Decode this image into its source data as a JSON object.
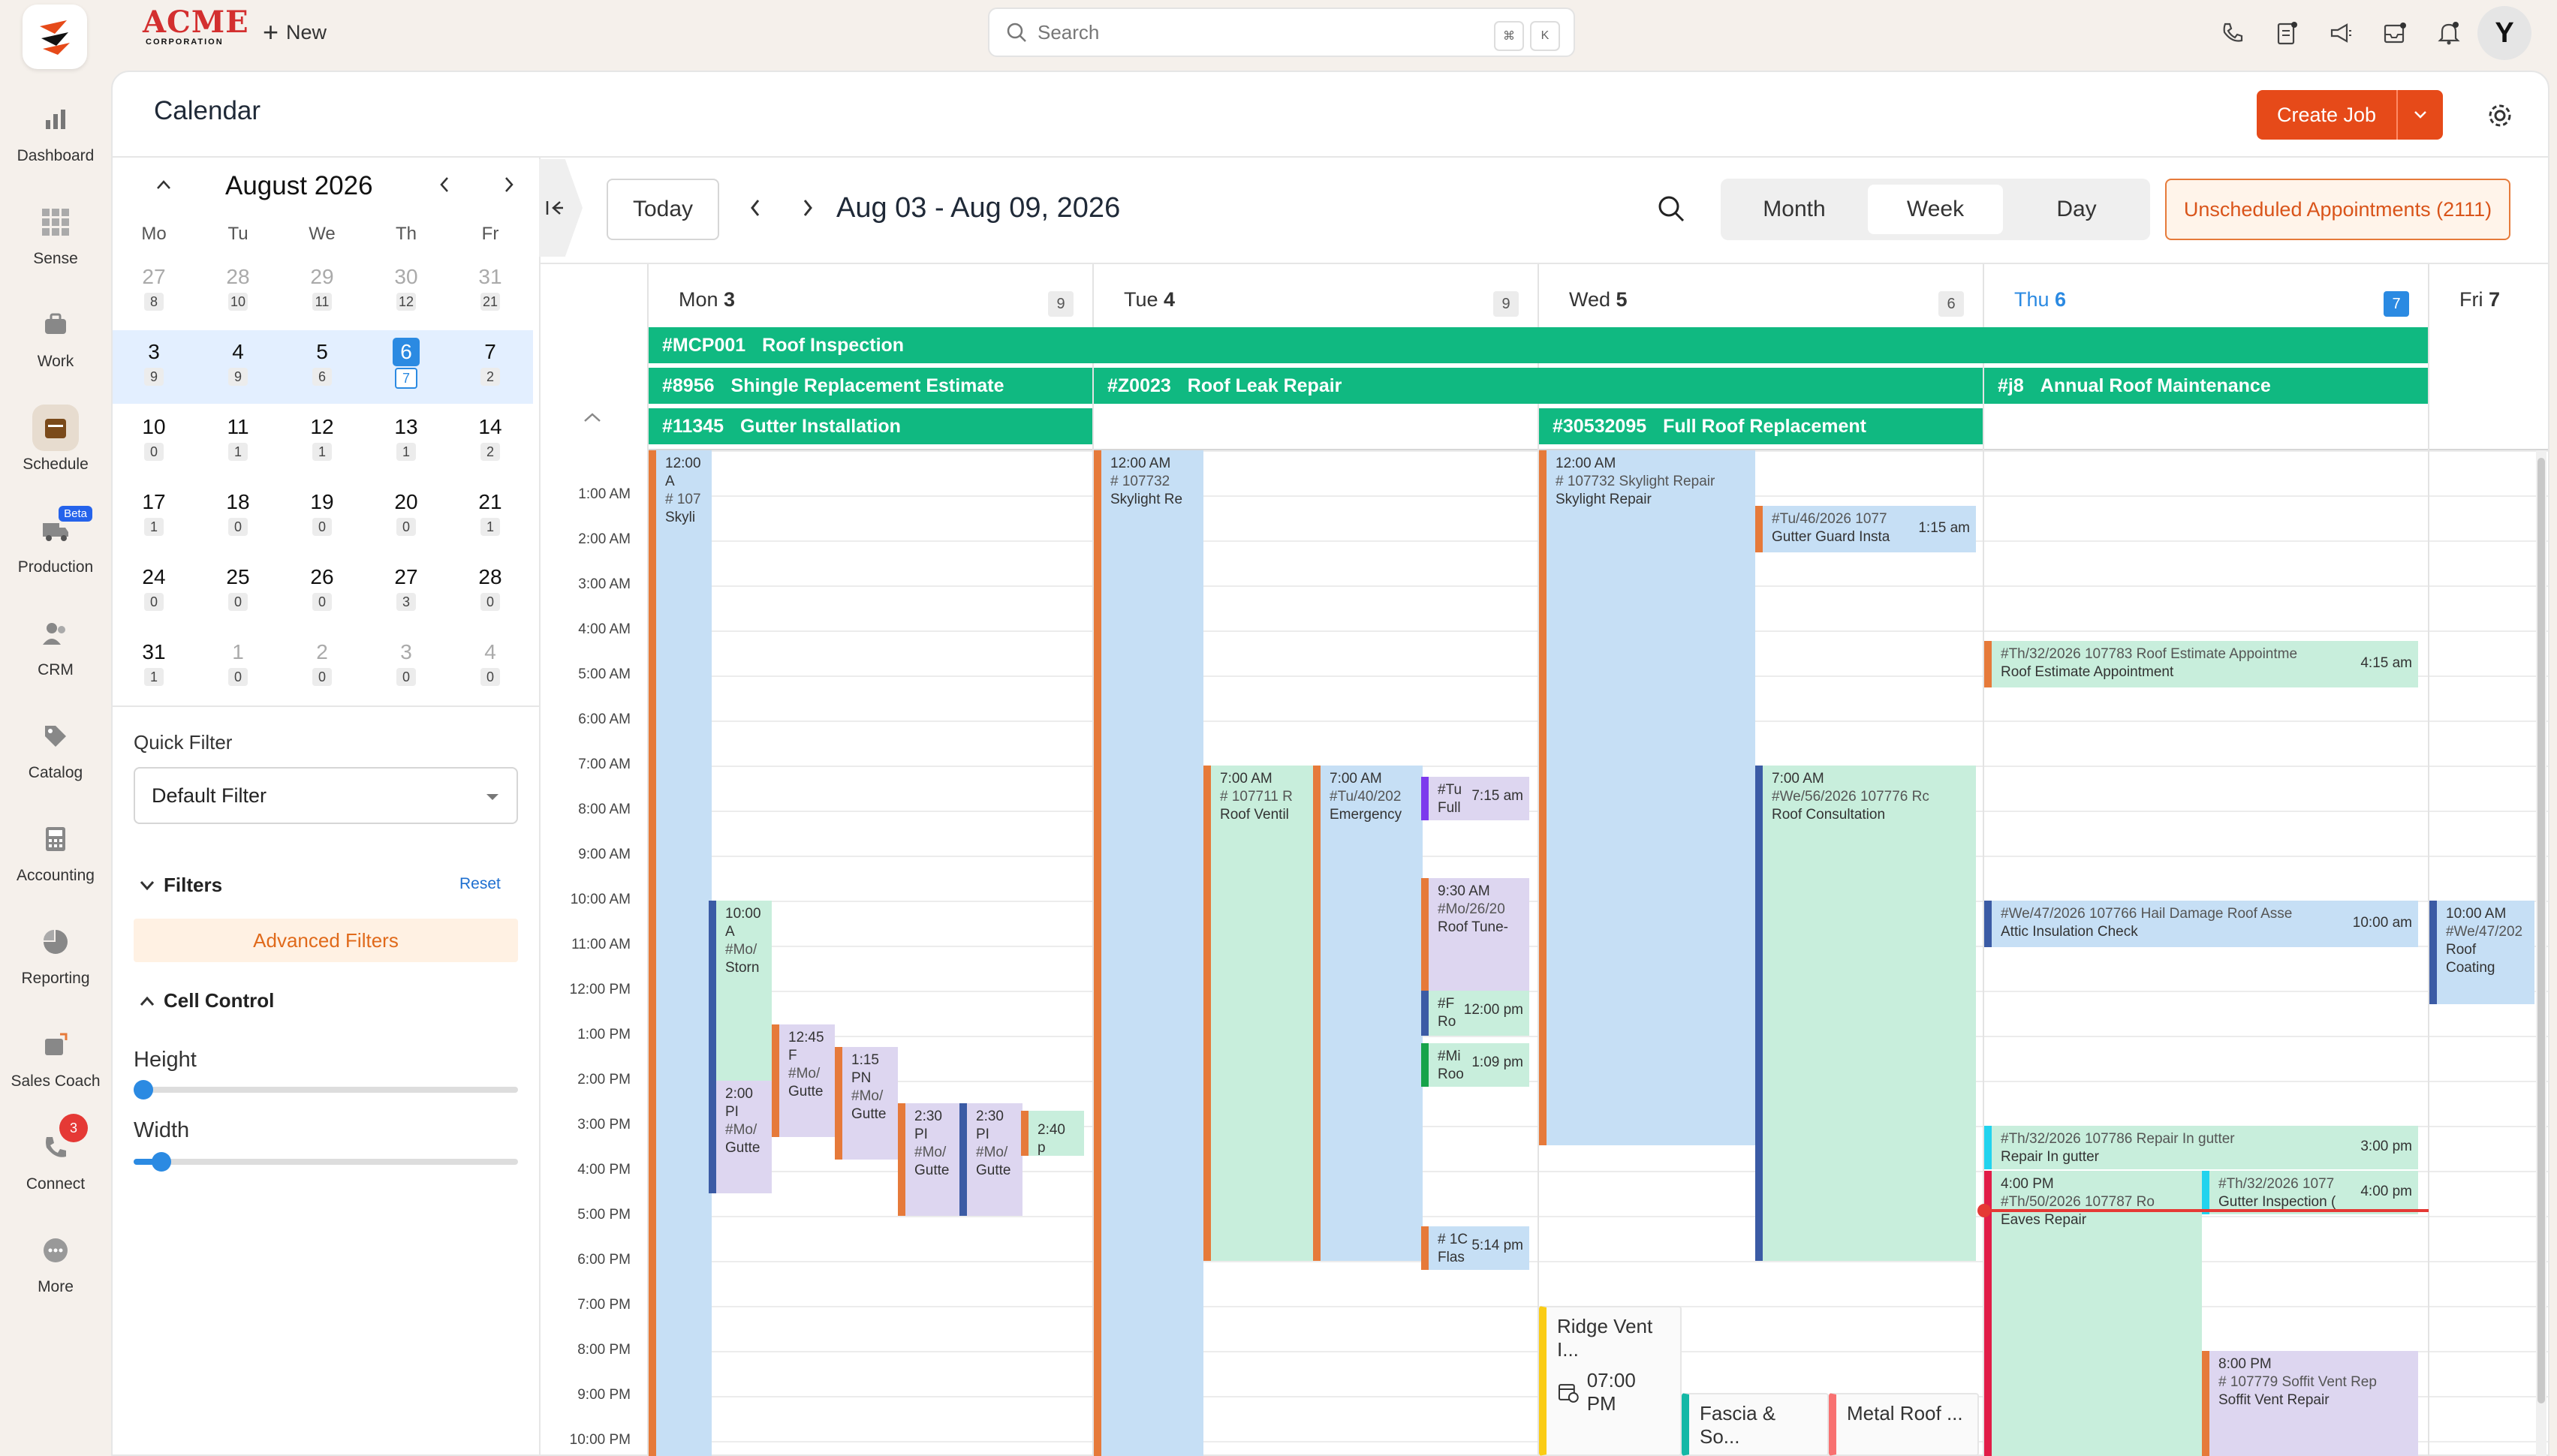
{
  "rail": {
    "items": [
      {
        "label": "Dashboard",
        "icon": "dashboard-icon"
      },
      {
        "label": "Sense",
        "icon": "sense-icon"
      },
      {
        "label": "Work",
        "icon": "work-icon"
      },
      {
        "label": "Schedule",
        "icon": "schedule-icon"
      },
      {
        "label": "Production",
        "icon": "production-icon",
        "badge": "Beta"
      },
      {
        "label": "CRM",
        "icon": "crm-icon"
      },
      {
        "label": "Catalog",
        "icon": "catalog-icon"
      },
      {
        "label": "Accounting",
        "icon": "accounting-icon"
      },
      {
        "label": "Reporting",
        "icon": "reporting-icon"
      },
      {
        "label": "Sales Coach",
        "icon": "sales-coach-icon"
      },
      {
        "label": "Connect",
        "icon": "connect-icon",
        "notif": "3"
      },
      {
        "label": "More",
        "icon": "more-icon"
      }
    ]
  },
  "topbar": {
    "brand": "ACME",
    "brand_sub": "CORPORATION",
    "new_label": "New",
    "search_placeholder": "Search",
    "kbd1": "⌘",
    "kbd2": "K",
    "avatar": "Y"
  },
  "page": {
    "title": "Calendar",
    "create_job": "Create Job"
  },
  "mini_calendar": {
    "month": "August 2026",
    "dow": [
      "Mo",
      "Tu",
      "We",
      "Th",
      "Fr"
    ],
    "weeks": [
      [
        {
          "d": "27",
          "c": "8",
          "m": true
        },
        {
          "d": "28",
          "c": "10",
          "m": true
        },
        {
          "d": "29",
          "c": "11",
          "m": true
        },
        {
          "d": "30",
          "c": "12",
          "m": true
        },
        {
          "d": "31",
          "c": "21",
          "m": true
        }
      ],
      [
        {
          "d": "3",
          "c": "9"
        },
        {
          "d": "4",
          "c": "9"
        },
        {
          "d": "5",
          "c": "6"
        },
        {
          "d": "6",
          "c": "7",
          "today": true
        },
        {
          "d": "7",
          "c": "2"
        }
      ],
      [
        {
          "d": "10",
          "c": "0"
        },
        {
          "d": "11",
          "c": "1"
        },
        {
          "d": "12",
          "c": "1"
        },
        {
          "d": "13",
          "c": "1"
        },
        {
          "d": "14",
          "c": "2"
        }
      ],
      [
        {
          "d": "17",
          "c": "1"
        },
        {
          "d": "18",
          "c": "0"
        },
        {
          "d": "19",
          "c": "0"
        },
        {
          "d": "20",
          "c": "0"
        },
        {
          "d": "21",
          "c": "1"
        }
      ],
      [
        {
          "d": "24",
          "c": "0"
        },
        {
          "d": "25",
          "c": "0"
        },
        {
          "d": "26",
          "c": "0"
        },
        {
          "d": "27",
          "c": "3"
        },
        {
          "d": "28",
          "c": "0"
        }
      ],
      [
        {
          "d": "31",
          "c": "1"
        },
        {
          "d": "1",
          "c": "0",
          "m": true
        },
        {
          "d": "2",
          "c": "0",
          "m": true
        },
        {
          "d": "3",
          "c": "0",
          "m": true
        },
        {
          "d": "4",
          "c": "0",
          "m": true
        }
      ]
    ]
  },
  "filters": {
    "quick_filter_label": "Quick Filter",
    "quick_filter_value": "Default Filter",
    "filters_label": "Filters",
    "reset": "Reset",
    "advanced": "Advanced Filters",
    "cell_control": "Cell Control",
    "height": "Height",
    "width": "Width",
    "height_value": 0,
    "width_value": 0.05
  },
  "toolbar": {
    "today": "Today",
    "range": "Aug 03 - Aug 09, 2026",
    "views": [
      "Month",
      "Week",
      "Day"
    ],
    "active_view": "Week",
    "unscheduled": "Unscheduled Appointments (2111)"
  },
  "days": [
    {
      "label": "Mon",
      "num": "3",
      "count": "9"
    },
    {
      "label": "Tue",
      "num": "4",
      "count": "9"
    },
    {
      "label": "Wed",
      "num": "5",
      "count": "6"
    },
    {
      "label": "Thu",
      "num": "6",
      "count": "7",
      "today": true
    },
    {
      "label": "Fri",
      "num": "7",
      "count": ""
    }
  ],
  "times": [
    "1:00 AM",
    "2:00 AM",
    "3:00 AM",
    "4:00 AM",
    "5:00 AM",
    "6:00 AM",
    "7:00 AM",
    "8:00 AM",
    "9:00 AM",
    "10:00 AM",
    "11:00 AM",
    "12:00 PM",
    "1:00 PM",
    "2:00 PM",
    "3:00 PM",
    "4:00 PM",
    "5:00 PM",
    "6:00 PM",
    "7:00 PM",
    "8:00 PM",
    "9:00 PM",
    "10:00 PM"
  ],
  "allday": [
    {
      "id": "#MCP001",
      "title": "Roof Inspection"
    },
    {
      "id": "#8956",
      "title": "Shingle Replacement Estimate"
    },
    {
      "id": "#Z0023",
      "title": "Roof Leak Repair"
    },
    {
      "id": "#j8",
      "title": "Annual Roof Maintenance"
    },
    {
      "id": "#11345",
      "title": "Gutter Installation"
    },
    {
      "id": "#30532095",
      "title": "Full Roof Replacement"
    }
  ],
  "events": [
    {
      "l1": "12:00 A",
      "l2": "# 107",
      "l3": "Skyli"
    },
    {
      "l1": "10:00 A",
      "l2": "#Mo/",
      "l3": "Storn"
    },
    {
      "l1": "12:45 F",
      "l2": "#Mo/",
      "l3": "Gutte"
    },
    {
      "l1": "1:15 PN",
      "l2": "#Mo/",
      "l3": "Gutte"
    },
    {
      "l1": "2:00 PI",
      "l2": "#Mo/",
      "l3": "Gutte"
    },
    {
      "l1": "2:30 PI",
      "l2": "#Mo/",
      "l3": "Gutte"
    },
    {
      "l1": "2:30 PI",
      "l2": "#Mo/",
      "l3": "Gutte"
    },
    {
      "l1": "2:40 p",
      "l2": "",
      "l3": ""
    },
    {
      "l1": "12:00 AM",
      "l2": "# 107732",
      "l3": "Skylight Re"
    },
    {
      "l1": "7:00 AM",
      "l2": "# 107711   R",
      "l3": "Roof Ventil"
    },
    {
      "l1": "7:00 AM",
      "l2": "#Tu/40/202",
      "l3": "Emergency"
    },
    {
      "l1": "#Tu",
      "l2": "Full",
      "r": "7:15 am"
    },
    {
      "l1": "9:30 AM",
      "l2": "#Mo/26/20",
      "l3": "Roof Tune-"
    },
    {
      "l1": "#F",
      "l2": "Ro",
      "r": "12:00 pm"
    },
    {
      "l1": "#Mi",
      "l2": "Roo",
      "r": "1:09 pm"
    },
    {
      "l1": "# 1C",
      "l2": "Flas",
      "r": "5:14 pm"
    },
    {
      "l1": "12:00 AM",
      "l2": "# 107732    Skylight Repair",
      "l3": "Skylight Repair"
    },
    {
      "l1": "#Tu/46/2026 1077",
      "l2": "Gutter Guard Insta",
      "r": "1:15 am"
    },
    {
      "l1": "7:00 AM",
      "l2": "#We/56/2026 107776   Rc",
      "l3": "Roof Consultation"
    },
    {
      "l1": "#Th/32/2026 107783    Roof Estimate Appointme",
      "l2": "Roof Estimate Appointment",
      "r": "4:15 am"
    },
    {
      "l1": "#We/47/2026 107766    Hail Damage Roof Asse",
      "l2": "Attic Insulation Check",
      "r": "10:00 am"
    },
    {
      "l1": "#Th/32/2026 107786    Repair In gutter",
      "l2": "Repair In gutter",
      "r": "3:00 pm"
    },
    {
      "l1": "4:00 PM",
      "l2": "#Th/50/2026 107787    Ro",
      "l3": "Eaves Repair"
    },
    {
      "l1": "#Th/32/2026 1077",
      "l2": "Gutter Inspection (",
      "r": "4:00 pm"
    },
    {
      "l1": "8:00 PM",
      "l2": "# 107779    Soffit Vent Rep",
      "l3": "Soffit Vent Repair"
    },
    {
      "l1": "10:00 AM",
      "l2": "#We/47/202",
      "l3": "Roof Coating"
    }
  ],
  "cards": [
    {
      "title": "Ridge Vent I...",
      "time": "07:00 PM"
    },
    {
      "title": "Fascia & So..."
    },
    {
      "title": "Metal Roof ..."
    }
  ],
  "colors": {
    "accent": "#e64a19",
    "allday": "#10b981",
    "today": "#2b8ae2",
    "now": "#e53935"
  }
}
